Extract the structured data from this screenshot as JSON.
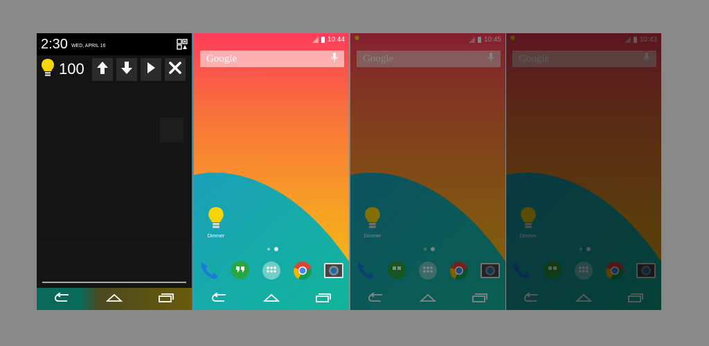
{
  "panel1": {
    "time": "2:30",
    "date": "WED, APRIL 16",
    "brightness_value": "100",
    "controls": [
      "up-arrow",
      "down-arrow",
      "play",
      "close"
    ]
  },
  "panel2": {
    "status_time": "10:44",
    "search_logo": "Google",
    "app_label": "Dimmer"
  },
  "panel3": {
    "status_time": "10:45",
    "search_logo": "Google",
    "app_label": "Dimmer"
  },
  "panel4": {
    "status_time": "10:43",
    "search_logo": "Google",
    "app_label": "Dimmer"
  },
  "dock_apps": [
    "phone-icon",
    "hangouts-icon",
    "app-drawer-icon",
    "chrome-icon",
    "camera-icon"
  ],
  "nav_buttons": [
    "back-icon",
    "home-icon",
    "recents-icon"
  ],
  "colors": {
    "wall_top": "#ff4a5a",
    "wall_mid": "#f7882f",
    "wall_bottom": "#f8c31a",
    "teal": "#18a3b3",
    "bulb": "#f5d50a",
    "dim_overlay_3": "rgba(0,0,0,0.48)",
    "dim_overlay_4": "rgba(0,0,0,0.64)"
  }
}
